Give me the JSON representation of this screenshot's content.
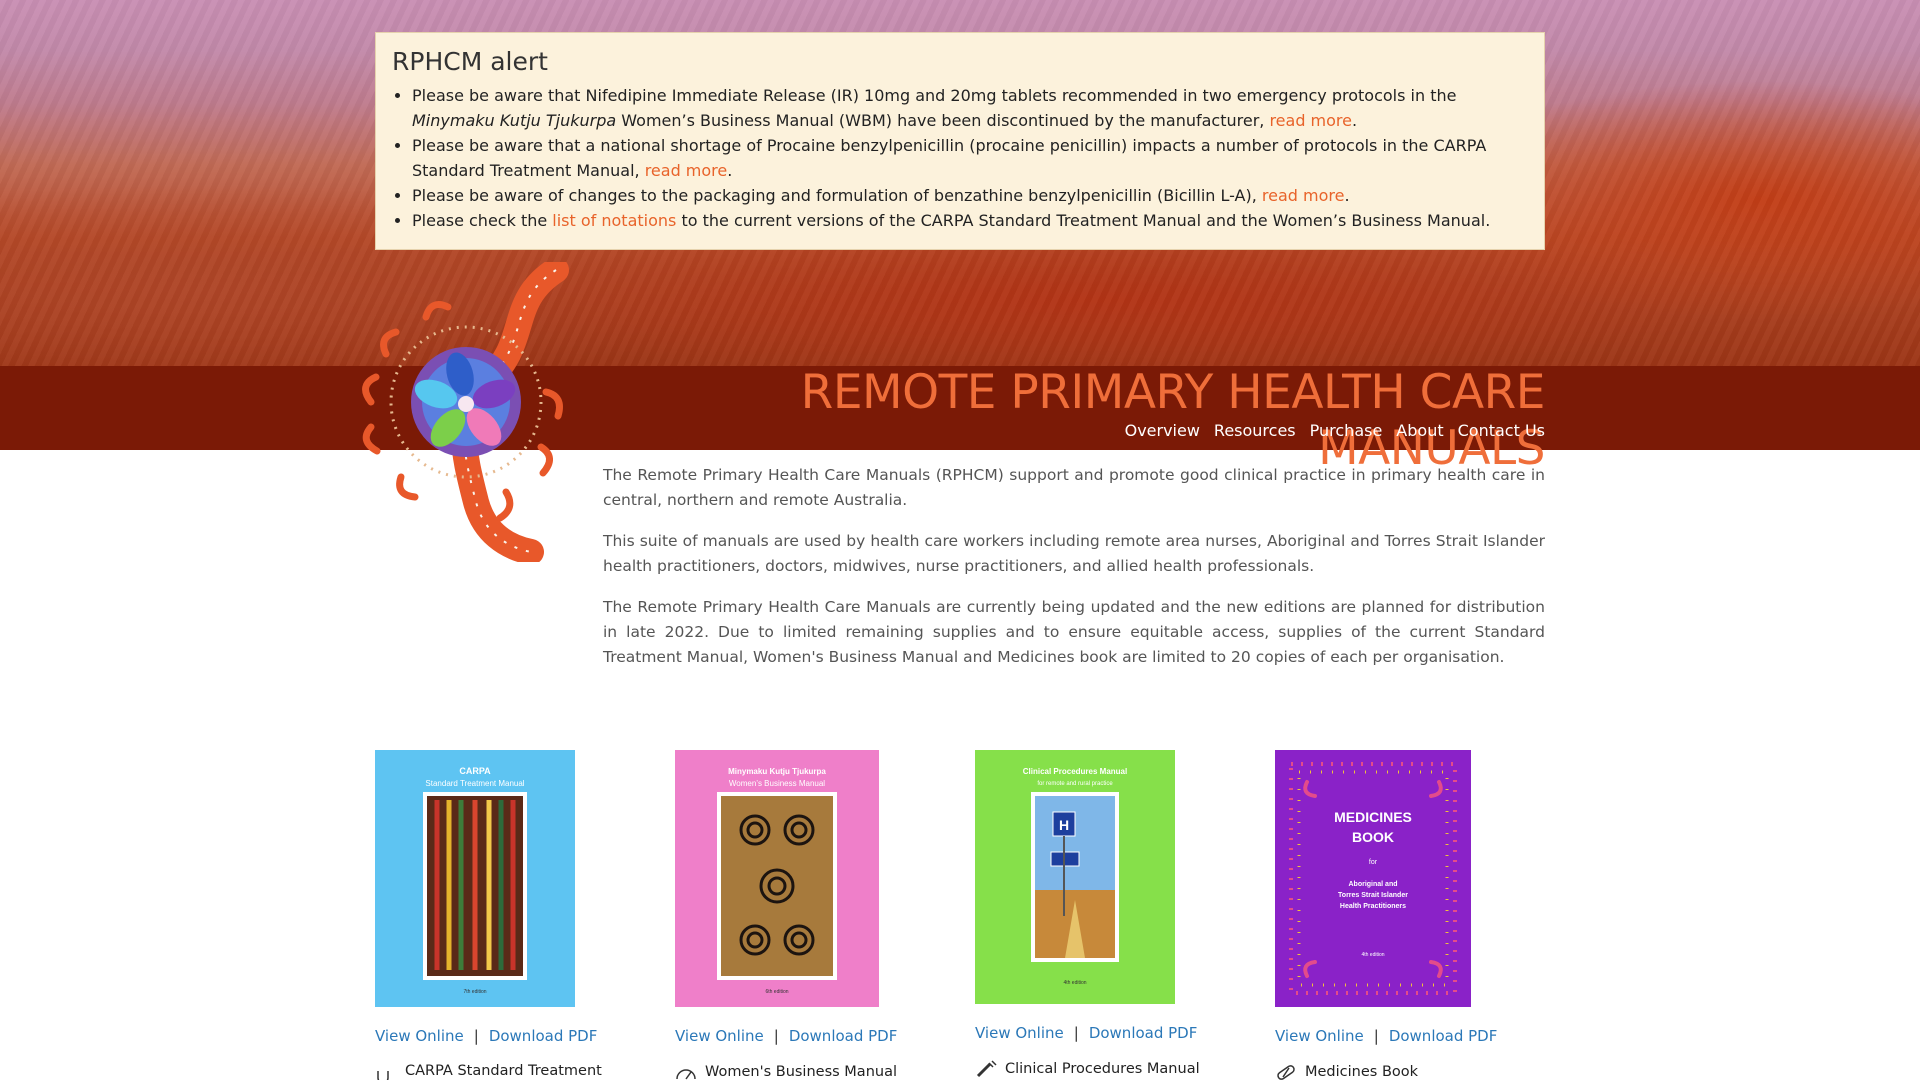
{
  "alert": {
    "title": "RPHCM alert",
    "items": [
      {
        "pre": "Please be aware that Nifedipine Immediate Release (IR) 10mg and 20mg tablets recommended in two emergency protocols in the ",
        "em": "Minymaku Kutju Tjukurpa",
        "post": " Women’s Business Manual (WBM) have been discontinued by the manufacturer, ",
        "link": "read more",
        "end": "."
      },
      {
        "pre": "Please be aware that a national shortage of Procaine benzylpenicillin (procaine penicillin) impacts a number of protocols in the CARPA Standard Treatment Manual, ",
        "link": "read more",
        "end": "."
      },
      {
        "pre": "Please be aware of changes to the packaging and formulation of benzathine benzylpenicillin (Bicillin L-A), ",
        "link": "read more",
        "end": "."
      },
      {
        "pre": "Please check the ",
        "link": "list of notations",
        "end": " to the current versions of the CARPA Standard Treatment Manual and the Women’s Business Manual."
      }
    ]
  },
  "site_title": "REMOTE PRIMARY HEALTH CARE MANUALS",
  "nav": [
    "Overview",
    "Resources",
    "Purchase",
    "About",
    "Contact Us"
  ],
  "intro": [
    "The Remote Primary Health Care Manuals (RPHCM) support and promote good clinical practice in primary health care in central, northern and remote Australia.",
    "This suite of manuals are used by health care workers including remote area nurses, Aboriginal and Torres Strait Islander health practitioners, doctors, midwives, nurse practitioners, and allied health professionals.",
    "The Remote Primary Health Care Manuals are currently being updated and the new editions are planned for distribution in late 2022. Due to limited remaining supplies and to ensure equitable access, supplies of the current Standard Treatment Manual, Women's Business Manual and Medicines book are limited to 20 copies of each per organisation."
  ],
  "manuals": [
    {
      "name": "CARPA Standard Treatment Manual",
      "view": "View Online",
      "sep": "|",
      "download": "Download PDF",
      "cover": {
        "line1": "CARPA",
        "line2": "Standard Treatment Manual",
        "edition": "7th edition",
        "color": "#5ec4f2"
      },
      "icon": "stethoscope-icon"
    },
    {
      "name": "Women's Business Manual",
      "view": "View Online",
      "sep": "|",
      "download": "Download PDF",
      "cover": {
        "line1": "Minymaku Kutju Tjukurpa",
        "line2": "Women’s Business Manual",
        "edition": "6th edition",
        "color": "#ef7fc9"
      },
      "icon": "gauge-icon"
    },
    {
      "name": "Clinical Procedures Manual",
      "view": "View Online",
      "sep": "|",
      "download": "Download PDF",
      "cover": {
        "line1": "Clinical Procedures Manual",
        "line2": "for remote and rural practice",
        "edition": "4th edition",
        "color": "#86e04a"
      },
      "icon": "syringe-icon"
    },
    {
      "name": "Medicines Book",
      "view": "View Online",
      "sep": "|",
      "download": "Download PDF",
      "cover": {
        "line1": "MEDICINES",
        "line2": "BOOK",
        "sub1": "for",
        "sub2": "Aboriginal and",
        "sub3": "Torres Strait Islander",
        "sub4": "Health Practitioners",
        "edition": "4th edition",
        "color": "#8a22c8"
      },
      "icon": "pill-icon"
    }
  ],
  "colors": {
    "accent": "#ef6e3a",
    "band": "#7b1a06",
    "link": "#2b78b8",
    "alert_bg": "#fcf2dc"
  }
}
